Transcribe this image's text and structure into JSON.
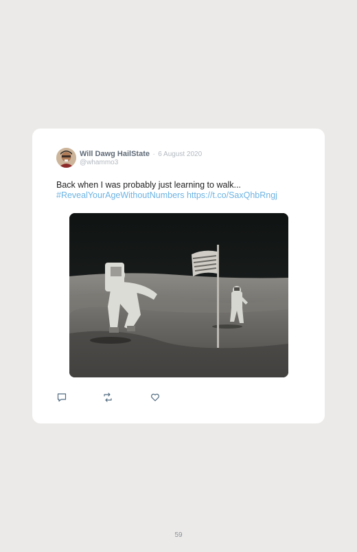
{
  "tweet": {
    "author_name": "Will Dawg HailState",
    "separator": "·",
    "date": "6 August 2020",
    "handle": "@whammo3",
    "text": "Back when I was probably just learning to walk...",
    "hashtag": "#RevealYourAgeWithoutNumbers",
    "url": "https://t.co/SaxQhbRngj",
    "media_description_icon": "moon-landing-photo"
  },
  "actions": [
    {
      "name": "reply",
      "icon": "reply-icon"
    },
    {
      "name": "retweet",
      "icon": "retweet-icon"
    },
    {
      "name": "like",
      "icon": "heart-icon"
    }
  ],
  "footer": {
    "page_number": "59"
  },
  "colors": {
    "background": "#ebeae8",
    "card": "#ffffff",
    "link": "#6cb3e3",
    "name": "#5f6a77",
    "muted": "#b3b9c0"
  }
}
